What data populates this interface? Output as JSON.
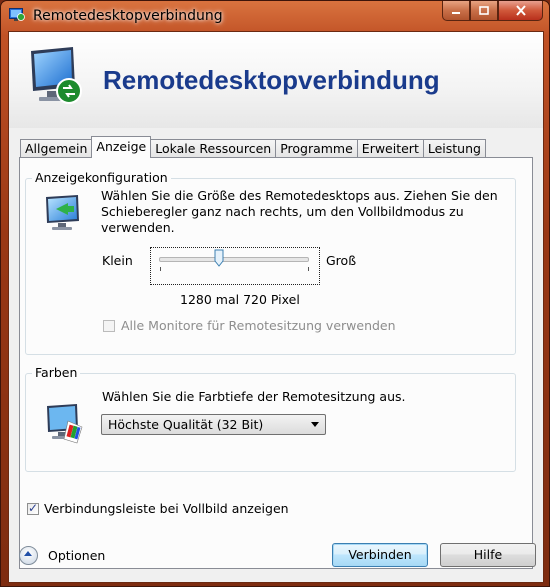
{
  "window": {
    "title": "Remotedesktopverbindung"
  },
  "banner": {
    "heading": "Remotedesktopverbindung"
  },
  "tabs": [
    {
      "label": "Allgemein"
    },
    {
      "label": "Anzeige",
      "active": true
    },
    {
      "label": "Lokale Ressourcen"
    },
    {
      "label": "Programme"
    },
    {
      "label": "Erweitert"
    },
    {
      "label": "Leistung"
    }
  ],
  "display_config": {
    "title": "Anzeigekonfiguration",
    "description_lines": [
      "Wählen Sie die Größe des Remotedesktops aus. Ziehen Sie den",
      "Schieberegler ganz nach rechts, um den Vollbildmodus zu",
      "verwenden."
    ],
    "slider_min_label": "Klein",
    "slider_max_label": "Groß",
    "slider_position_fraction": 0.4,
    "resolution_text": "1280 mal 720 Pixel",
    "all_monitors_label": "Alle Monitore für Remotesitzung verwenden",
    "all_monitors_checked": false,
    "all_monitors_enabled": false
  },
  "colors": {
    "title": "Farben",
    "description": "Wählen Sie die Farbtiefe der Remotesitzung aus.",
    "selected_depth": "Höchste Qualität (32 Bit)"
  },
  "connection_bar": {
    "label": "Verbindungsleiste bei Vollbild anzeigen",
    "checked": true
  },
  "footer": {
    "options_label": "Optionen",
    "connect_label": "Verbinden",
    "help_label": "Hilfe"
  },
  "icons": {
    "app": "remote-desktop-icon",
    "banner": "remote-desktop-monitor-icon",
    "display": "display-monitor-icon",
    "colors": "color-palette-monitor-icon",
    "options": "chevron-up-icon"
  },
  "theme": {
    "title_text": "#1a3b8c",
    "window_frame": "#9a3815"
  }
}
